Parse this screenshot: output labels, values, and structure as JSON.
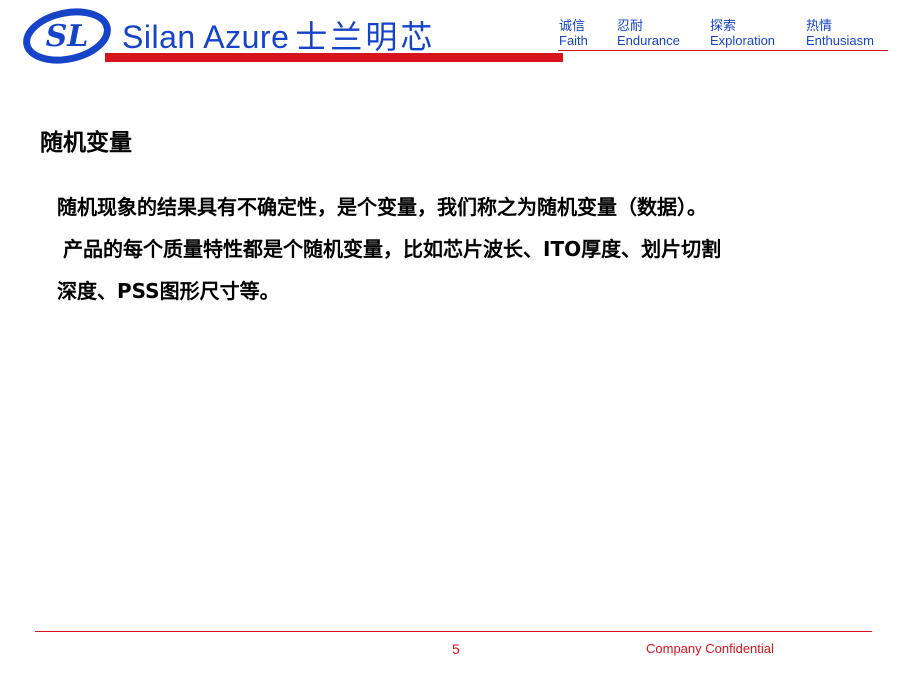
{
  "header": {
    "logo_text": "SL",
    "brand_name": "Silan Azure",
    "brand_name_cn": "士兰明芯",
    "values": [
      {
        "cn": "诚信",
        "en": "Faith"
      },
      {
        "cn": "忍耐",
        "en": "Endurance"
      },
      {
        "cn": "探索",
        "en": "Exploration"
      },
      {
        "cn": "热情",
        "en": "Enthusiasm"
      }
    ],
    "colors": {
      "brand_blue": "#1544c8",
      "accent_red": "#d5141c"
    }
  },
  "slide": {
    "title": "随机变量",
    "paragraphs": [
      "随机现象的结果具有不确定性，是个变量，我们称之为随机变量（数据）。",
      "产品的每个质量特性都是个随机变量，比如芯片波长、ITO厚度、划片切割",
      "深度、PSS图形尺寸等。"
    ]
  },
  "footer": {
    "page_number": "5",
    "confidential": "Company Confidential"
  }
}
